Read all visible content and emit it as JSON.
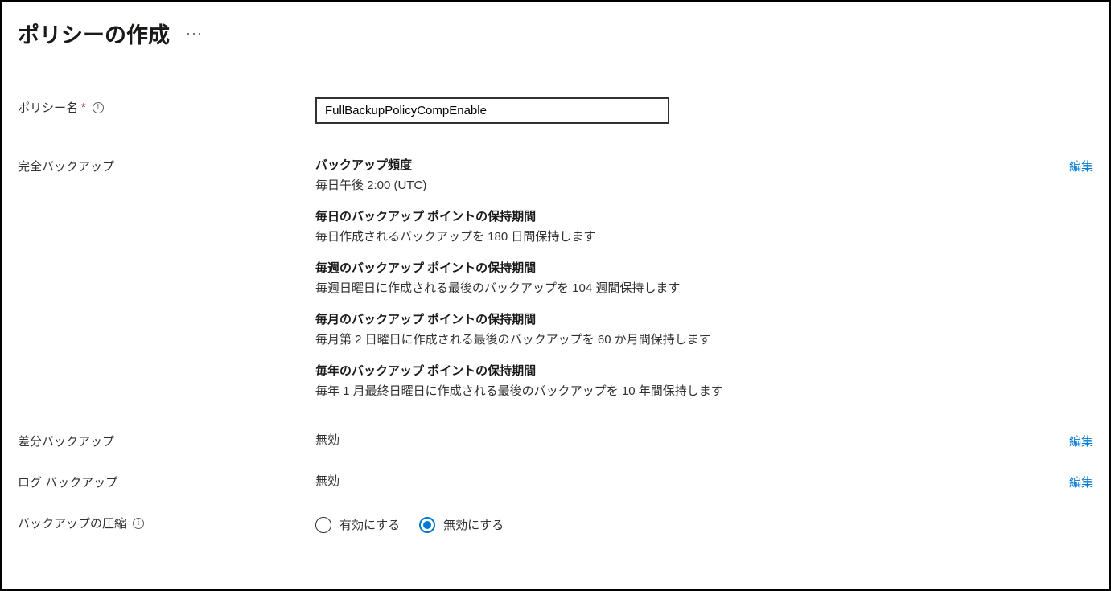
{
  "header": {
    "title": "ポリシーの作成"
  },
  "policyName": {
    "label": "ポリシー名",
    "value": "FullBackupPolicyCompEnable"
  },
  "fullBackup": {
    "label": "完全バックアップ",
    "editLabel": "編集",
    "sections": [
      {
        "heading": "バックアップ頻度",
        "desc": "毎日午後 2:00 (UTC)"
      },
      {
        "heading": "毎日のバックアップ ポイントの保持期間",
        "desc": "毎日作成されるバックアップを 180 日間保持します"
      },
      {
        "heading": "毎週のバックアップ ポイントの保持期間",
        "desc": "毎週日曜日に作成される最後のバックアップを 104 週間保持します"
      },
      {
        "heading": "毎月のバックアップ ポイントの保持期間",
        "desc": "毎月第 2 日曜日に作成される最後のバックアップを 60 か月間保持します"
      },
      {
        "heading": "毎年のバックアップ ポイントの保持期間",
        "desc": "毎年 1 月最終日曜日に作成される最後のバックアップを 10 年間保持します"
      }
    ]
  },
  "diffBackup": {
    "label": "差分バックアップ",
    "value": "無効",
    "editLabel": "編集"
  },
  "logBackup": {
    "label": "ログ バックアップ",
    "value": "無効",
    "editLabel": "編集"
  },
  "compression": {
    "label": "バックアップの圧縮",
    "enableLabel": "有効にする",
    "disableLabel": "無効にする",
    "selected": "disable"
  }
}
